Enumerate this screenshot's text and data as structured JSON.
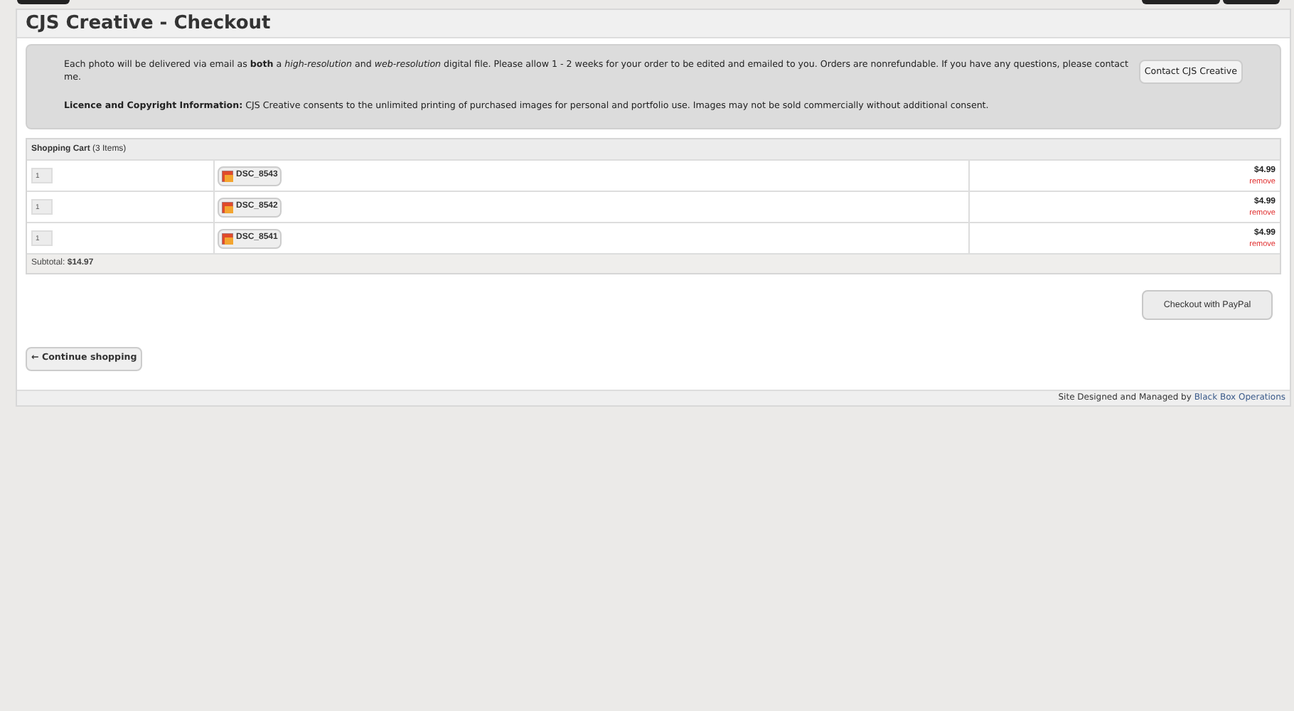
{
  "page": {
    "title": "CJS Creative - Checkout"
  },
  "notice": {
    "delivery_text": "Each photo will be delivered via email as **both** a *high-resolution* and *web-resolution* digital file. Please allow 1 - 2 weeks for your order to be edited and emailed to you. Orders are nonrefundable. If you have any questions, please contact me.",
    "contact_button": "Contact CJS Creative",
    "licence_text": "**Licence and Copyright Information:** CJS Creative consents to the unlimited printing of purchased images for personal and portfolio use. Images may not be sold commercially without additional consent."
  },
  "cart": {
    "title": "Shopping Cart",
    "count": "(3 Items)",
    "rows": [
      {
        "quantity": "1",
        "photo": "DSC_8543",
        "price": "$4.99",
        "remove": "remove"
      },
      {
        "quantity": "1",
        "photo": "DSC_8542",
        "price": "$4.99",
        "remove": "remove"
      },
      {
        "quantity": "1",
        "photo": "DSC_8541",
        "price": "$4.99",
        "remove": "remove"
      }
    ],
    "subtotal_label": "Subtotal:",
    "subtotal": "$14.97"
  },
  "checkout_button": "Checkout with PayPal",
  "continue_button": "← Continue shopping",
  "footer": {
    "text": "Site Designed and Managed by",
    "link": "Black Box Operations"
  }
}
